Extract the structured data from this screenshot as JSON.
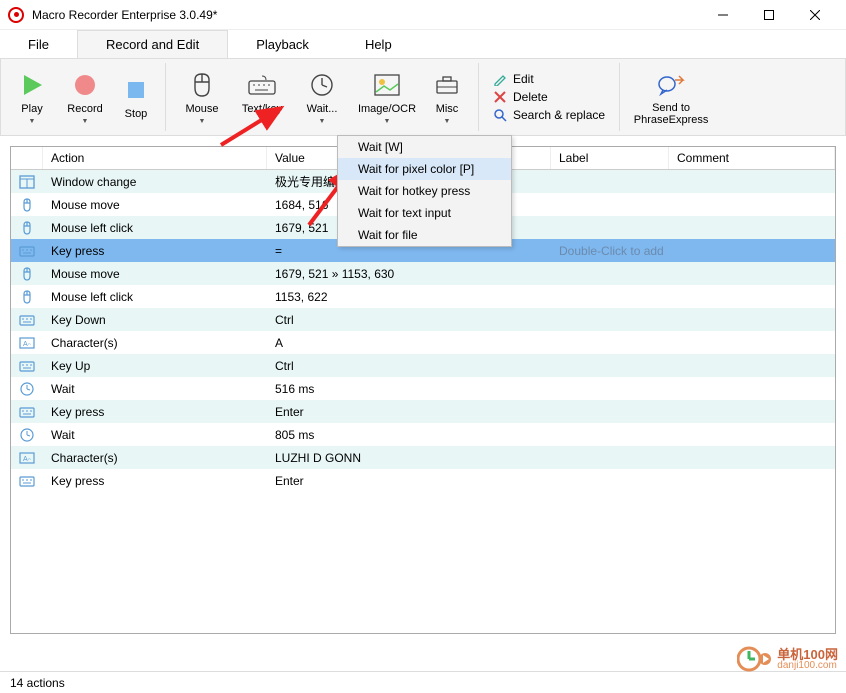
{
  "title": "Macro Recorder Enterprise 3.0.49*",
  "menu": {
    "file": "File",
    "record": "Record and Edit",
    "playback": "Playback",
    "help": "Help"
  },
  "ribbon": {
    "play": "Play",
    "record": "Record",
    "stop": "Stop",
    "mouse": "Mouse",
    "textkey": "Text/key",
    "wait": "Wait...",
    "imageocr": "Image/OCR",
    "misc": "Misc",
    "edit": "Edit",
    "delete": "Delete",
    "search": "Search & replace",
    "sendto": "Send to",
    "phrase": "PhraseExpress"
  },
  "dropdown": {
    "items": [
      "Wait [W]",
      "Wait for pixel color [P]",
      "Wait for hotkey press",
      "Wait for text input",
      "Wait for file"
    ]
  },
  "columns": {
    "action": "Action",
    "value": "Value",
    "label": "Label",
    "comment": "Comment"
  },
  "rows": [
    {
      "icon": "window",
      "action": "Window change",
      "value": "极光专用编"
    },
    {
      "icon": "mouse",
      "action": "Mouse move",
      "value": "1684, 516"
    },
    {
      "icon": "mouse",
      "action": "Mouse left click",
      "value": "1679, 521"
    },
    {
      "icon": "keyboard",
      "action": "Key press",
      "value": "=",
      "selected": true,
      "hint": "Double-Click to add"
    },
    {
      "icon": "mouse",
      "action": "Mouse move",
      "value": "1679, 521 » 1153, 630"
    },
    {
      "icon": "mouse",
      "action": "Mouse left click",
      "value": "1153, 622"
    },
    {
      "icon": "keyboard",
      "action": "Key Down",
      "value": "Ctrl"
    },
    {
      "icon": "chars",
      "action": "Character(s)",
      "value": "A"
    },
    {
      "icon": "keyboard",
      "action": "Key Up",
      "value": "Ctrl"
    },
    {
      "icon": "clock",
      "action": "Wait",
      "value": "516 ms"
    },
    {
      "icon": "keyboard",
      "action": "Key press",
      "value": "Enter"
    },
    {
      "icon": "clock",
      "action": "Wait",
      "value": "805 ms"
    },
    {
      "icon": "chars",
      "action": "Character(s)",
      "value": "LUZHI D GONN"
    },
    {
      "icon": "keyboard",
      "action": "Key press",
      "value": "Enter"
    }
  ],
  "status": "14 actions",
  "watermark": {
    "line1": "单机100网",
    "line2": "danji100.com"
  }
}
